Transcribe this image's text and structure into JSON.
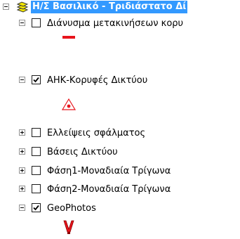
{
  "layers": {
    "root": {
      "label": "Η/Σ Βασιλικό - Τριδιάστατο Δί",
      "expanded": true,
      "icon": "layer-group-icon"
    },
    "items": [
      {
        "label": "Διάνυσμα μετακινήσεων κορυ",
        "checked": false,
        "expanded": true,
        "symbol": "red-line-symbol"
      },
      {
        "label": "ΑΗΚ-Κορυφές Δικτύου",
        "checked": true,
        "expanded": true,
        "symbol": "red-triangle-dot-symbol"
      },
      {
        "label": "Ελλείψεις σφάλματος",
        "checked": false,
        "expanded": false
      },
      {
        "label": "Βάσεις Δικτύου",
        "checked": false,
        "expanded": false
      },
      {
        "label": "Φάση1-Μοναδιαία Τρίγωνα",
        "checked": false,
        "expanded": false
      },
      {
        "label": "Φάση2-Μοναδιαία Τρίγωνα",
        "checked": false,
        "expanded": false
      },
      {
        "label": "GeoPhotos",
        "checked": true,
        "expanded": true,
        "symbol": "red-v-marker-symbol"
      }
    ]
  },
  "colors": {
    "selection": "#3399ff",
    "symbol_red": "#e8141c"
  }
}
